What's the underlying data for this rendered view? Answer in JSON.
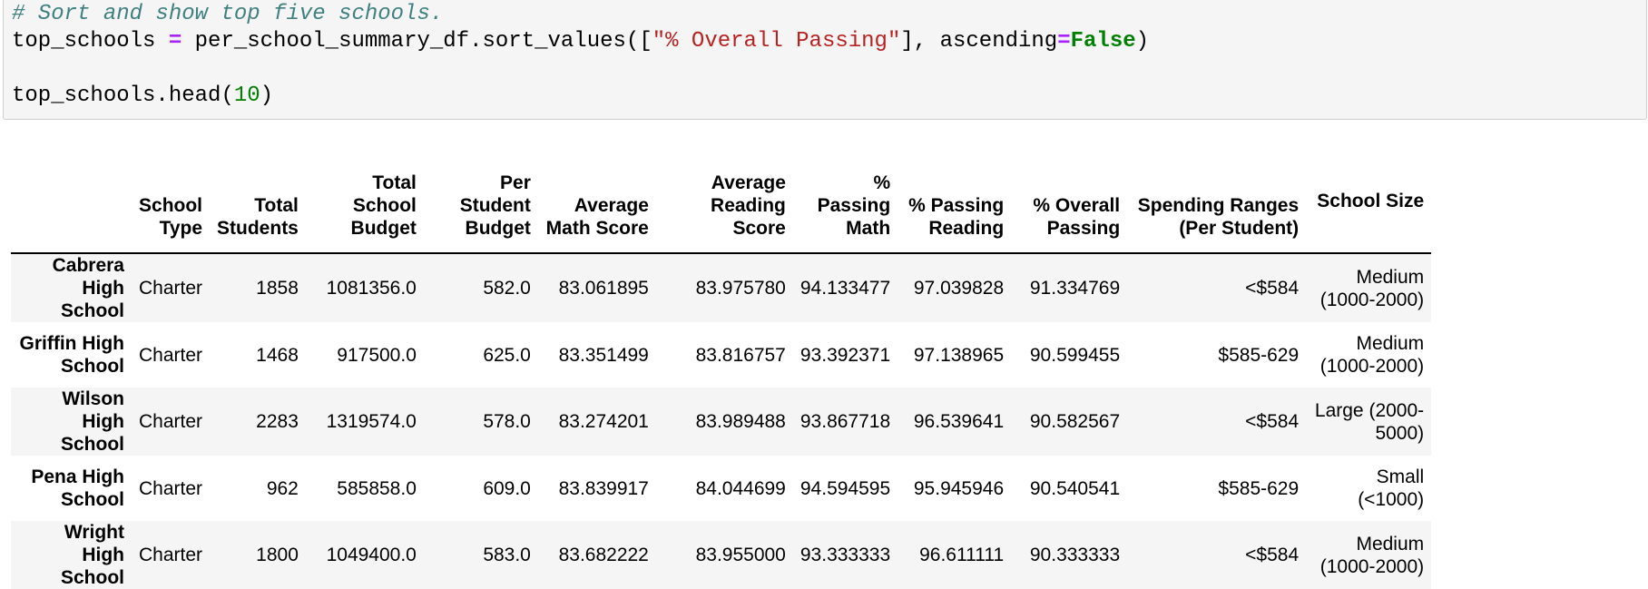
{
  "code": {
    "comment": "# Sort and show top five schools.",
    "line2": {
      "var": "top_schools ",
      "assign": "=",
      "call": " per_school_summary_df.sort_values([",
      "arg": "\"% Overall Passing\"",
      "mid": "], ascending",
      "eq": "=",
      "kw": "False",
      "close": ")"
    },
    "line3": {
      "call": "top_schools.head(",
      "num": "10",
      "close": ")"
    }
  },
  "table": {
    "columns": [
      [
        "School",
        "Type"
      ],
      [
        "Total",
        "Students"
      ],
      [
        "Total School",
        "Budget"
      ],
      [
        "Per Student",
        "Budget"
      ],
      [
        "Average",
        "Math Score"
      ],
      [
        "Average",
        "Reading Score"
      ],
      [
        "%",
        "Passing",
        "Math"
      ],
      [
        "% Passing",
        "Reading"
      ],
      [
        "% Overall",
        "Passing"
      ],
      [
        "Spending Ranges",
        "(Per Student)"
      ],
      [
        "School Size"
      ]
    ],
    "rows": [
      {
        "index": [
          "Cabrera",
          "High School"
        ],
        "cells": [
          "Charter",
          "1858",
          "1081356.0",
          "582.0",
          "83.061895",
          "83.975780",
          "94.133477",
          "97.039828",
          "91.334769",
          "<$584"
        ],
        "size": [
          "Medium",
          "(1000-2000)"
        ]
      },
      {
        "index": [
          "Griffin High",
          "School"
        ],
        "cells": [
          "Charter",
          "1468",
          "917500.0",
          "625.0",
          "83.351499",
          "83.816757",
          "93.392371",
          "97.138965",
          "90.599455",
          "$585-629"
        ],
        "size": [
          "Medium",
          "(1000-2000)"
        ]
      },
      {
        "index": [
          "Wilson High",
          "School"
        ],
        "cells": [
          "Charter",
          "2283",
          "1319574.0",
          "578.0",
          "83.274201",
          "83.989488",
          "93.867718",
          "96.539641",
          "90.582567",
          "<$584"
        ],
        "size": [
          "Large (2000-",
          "5000)"
        ]
      },
      {
        "index": [
          "Pena High",
          "School"
        ],
        "cells": [
          "Charter",
          "962",
          "585858.0",
          "609.0",
          "83.839917",
          "84.044699",
          "94.594595",
          "95.945946",
          "90.540541",
          "$585-629"
        ],
        "size": [
          "Small",
          "(<1000)"
        ]
      },
      {
        "index": [
          "Wright High",
          "School"
        ],
        "cells": [
          "Charter",
          "1800",
          "1049400.0",
          "583.0",
          "83.682222",
          "83.955000",
          "93.333333",
          "96.611111",
          "90.333333",
          "<$584"
        ],
        "size": [
          "Medium",
          "(1000-2000)"
        ]
      }
    ]
  }
}
